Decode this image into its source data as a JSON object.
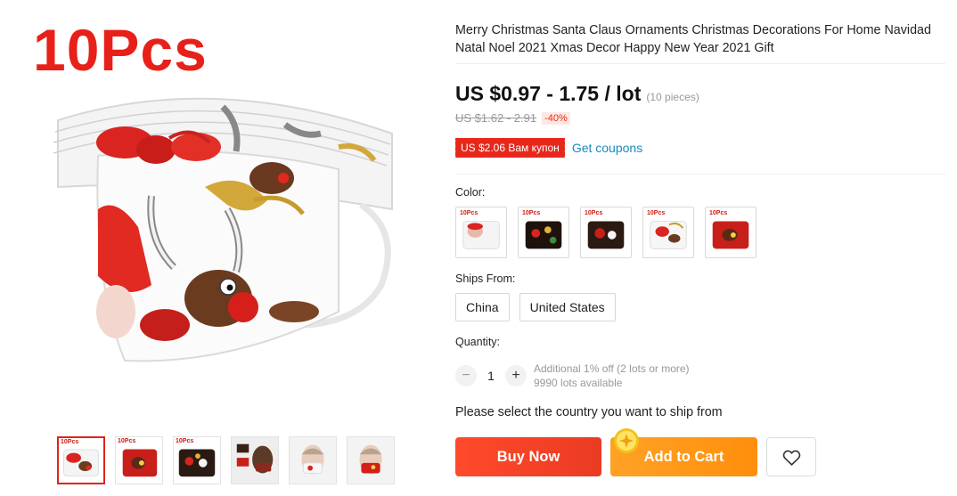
{
  "gallery": {
    "badge": "10Pcs",
    "thumb_label": "10Pcs",
    "thumbnails": [
      {
        "name": "thumbnail-1",
        "label": "10Pcs"
      },
      {
        "name": "thumbnail-2",
        "label": "10Pcs"
      },
      {
        "name": "thumbnail-3",
        "label": "10Pcs"
      },
      {
        "name": "thumbnail-4",
        "label": ""
      },
      {
        "name": "thumbnail-5",
        "label": ""
      },
      {
        "name": "thumbnail-6",
        "label": ""
      }
    ]
  },
  "product": {
    "title": "Merry Christmas Santa Claus Ornaments Christmas Decorations For Home Navidad Natal Noel 2021 Xmas Decor Happy New Year 2021 Gift",
    "price": "US $0.97 - 1.75 / lot",
    "pieces": "(10 pieces)",
    "old_price": "US $1.62 - 2.91",
    "discount": "-40%",
    "coupon": "US $2.06 Вам купон",
    "get_coupons": "Get coupons"
  },
  "color": {
    "label": "Color:",
    "options": [
      {
        "label": "10Pcs"
      },
      {
        "label": "10Pcs"
      },
      {
        "label": "10Pcs"
      },
      {
        "label": "10Pcs"
      },
      {
        "label": "10Pcs"
      }
    ]
  },
  "ships_from": {
    "label": "Ships From:",
    "options": [
      "China",
      "United States"
    ]
  },
  "quantity": {
    "label": "Quantity:",
    "minus": "−",
    "value": "1",
    "plus": "+",
    "note_line1": "Additional 1% off (2 lots or more)",
    "note_line2": "9990 lots available"
  },
  "ship_message": "Please select the country you want to ship from",
  "actions": {
    "buy_now": "Buy Now",
    "add_to_cart": "Add to Cart",
    "wishlist_icon": "heart-icon"
  },
  "colors": {
    "accent_red": "#e8271b",
    "buy_now": "#ff4a2b",
    "add_to_cart": "#ffa225",
    "link_blue": "#1a8bbf"
  }
}
